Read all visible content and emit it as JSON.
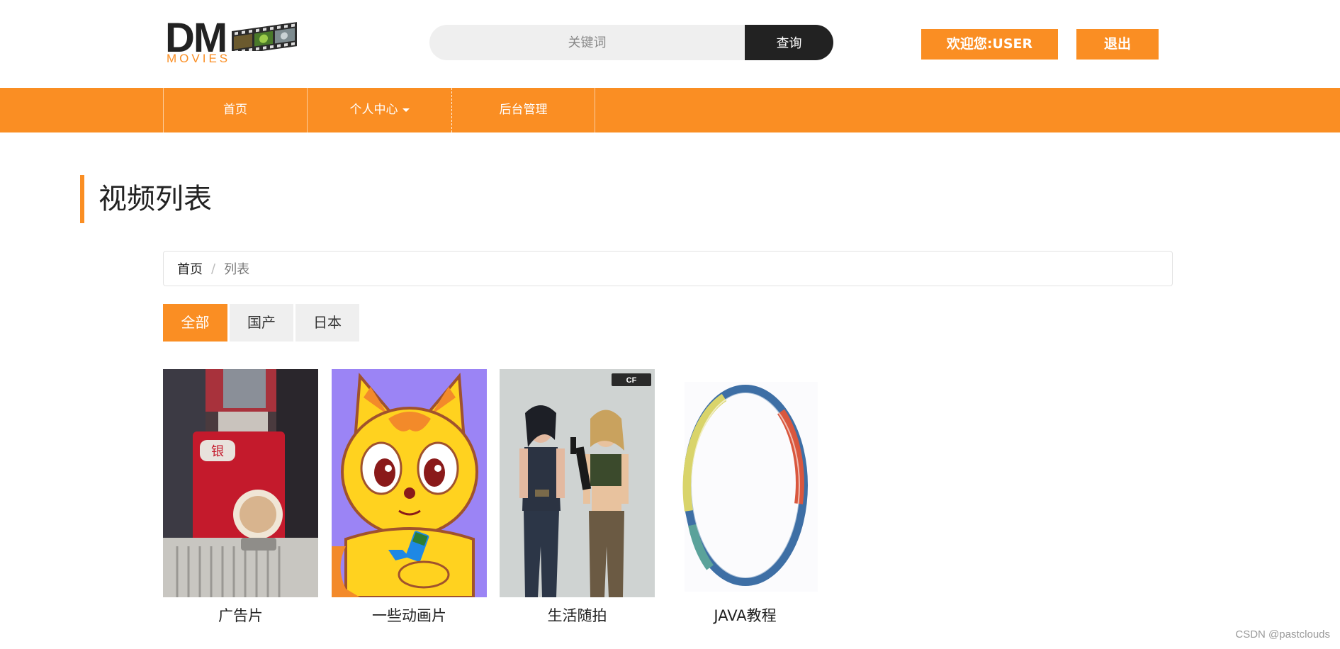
{
  "header": {
    "logo": {
      "letters": "DM",
      "subtitle": "MOVIES"
    },
    "search": {
      "placeholder": "关键词",
      "button_label": "查询"
    },
    "welcome_label": "欢迎您:USER",
    "logout_label": "退出"
  },
  "nav": {
    "items": [
      {
        "label": "首页"
      },
      {
        "label": "个人中心"
      },
      {
        "label": "后台管理"
      }
    ]
  },
  "page": {
    "title": "视频列表"
  },
  "breadcrumb": {
    "home": "首页",
    "separator": "/",
    "current": "列表"
  },
  "filters": {
    "tabs": [
      {
        "label": "全部",
        "active": true
      },
      {
        "label": "国产",
        "active": false
      },
      {
        "label": "日本",
        "active": false
      }
    ]
  },
  "videos": [
    {
      "title": "广告片"
    },
    {
      "title": "一些动画片"
    },
    {
      "title": "生活随拍"
    },
    {
      "title": "JAVA教程"
    }
  ],
  "footer": {
    "watermark": "CSDN @pastclouds"
  },
  "colors": {
    "accent": "#fa8e23",
    "dark": "#222222",
    "light_gray": "#efefef"
  }
}
